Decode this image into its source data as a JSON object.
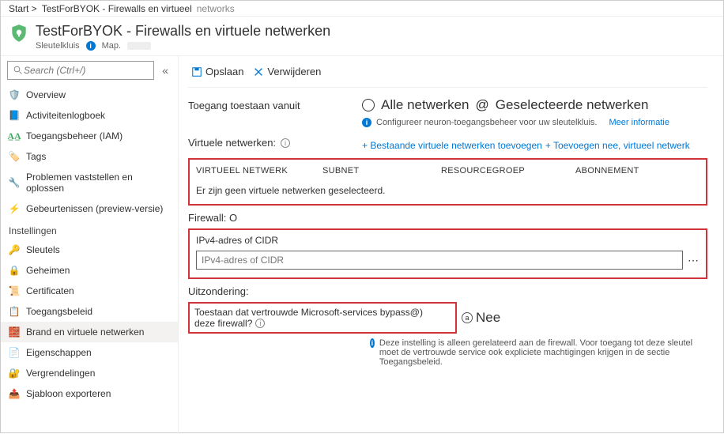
{
  "breadcrumb": {
    "start": "Start >",
    "item": "TestForBYOK - Firewalls en virtueel",
    "tail": "networks"
  },
  "header": {
    "title": "TestForBYOK - Firewalls en virtuele netwerken",
    "subtitle": "Sleutelkluis",
    "map": "Map."
  },
  "search": {
    "placeholder": "Search (Ctrl+/)"
  },
  "nav": {
    "top": [
      {
        "key": "overview",
        "label": "Overview"
      },
      {
        "key": "activity",
        "label": "Activiteitenlogboek"
      },
      {
        "key": "iam",
        "label": "Toegangsbeheer (IAM)"
      },
      {
        "key": "tags",
        "label": "Tags"
      },
      {
        "key": "diag",
        "label": "Problemen vaststellen en oplossen"
      },
      {
        "key": "events",
        "label": "Gebeurtenissen (preview-versie)"
      }
    ],
    "group": "Instellingen",
    "items": [
      {
        "key": "keys",
        "label": "Sleutels"
      },
      {
        "key": "secrets",
        "label": "Geheimen"
      },
      {
        "key": "certs",
        "label": "Certificaten"
      },
      {
        "key": "access",
        "label": "Toegangsbeleid"
      },
      {
        "key": "firewall",
        "label": "Brand en virtuele netwerken"
      },
      {
        "key": "props",
        "label": "Eigenschappen"
      },
      {
        "key": "locks",
        "label": "Vergrendelingen"
      },
      {
        "key": "export",
        "label": "Sjabloon exporteren"
      }
    ]
  },
  "toolbar": {
    "save": "Opslaan",
    "discard": "Verwijderen"
  },
  "access": {
    "label": "Toegang toestaan vanuit",
    "opt1": "Alle netwerken",
    "opt2": "Geselecteerde netwerken",
    "at": "@"
  },
  "note1": {
    "text": "Configureer neuron-toegangsbeheer voor uw sleutelkluis.",
    "more": "Meer informatie"
  },
  "vnet": {
    "title": "Virtuele netwerken:",
    "add1": "+ Bestaande virtuele netwerken toevoegen",
    "add2": "+ Toevoegen nee, virtueel netwerk",
    "col1": "VIRTUEEL NETWERK",
    "col2": "SUBNET",
    "col3": "RESOURCEGROEP",
    "col4": "ABONNEMENT",
    "empty": "Er zijn geen virtuele netwerken geselecteerd."
  },
  "firewall": {
    "title": "Firewall: O",
    "iplabel": "IPv4-adres of CIDR",
    "ipplaceholder": "IPv4-adres of CIDR"
  },
  "exception": {
    "title": "Uitzondering:",
    "text1": "Toestaan dat vertrouwde Microsoft-services bypass@)",
    "text2": "deze firewall?",
    "a": "a",
    "answer": "Nee"
  },
  "foot": "Deze instelling is alleen gerelateerd aan de firewall. Voor toegang tot deze sleutel moet de vertrouwde service ook expliciete machtigingen krijgen in de sectie Toegangsbeleid."
}
